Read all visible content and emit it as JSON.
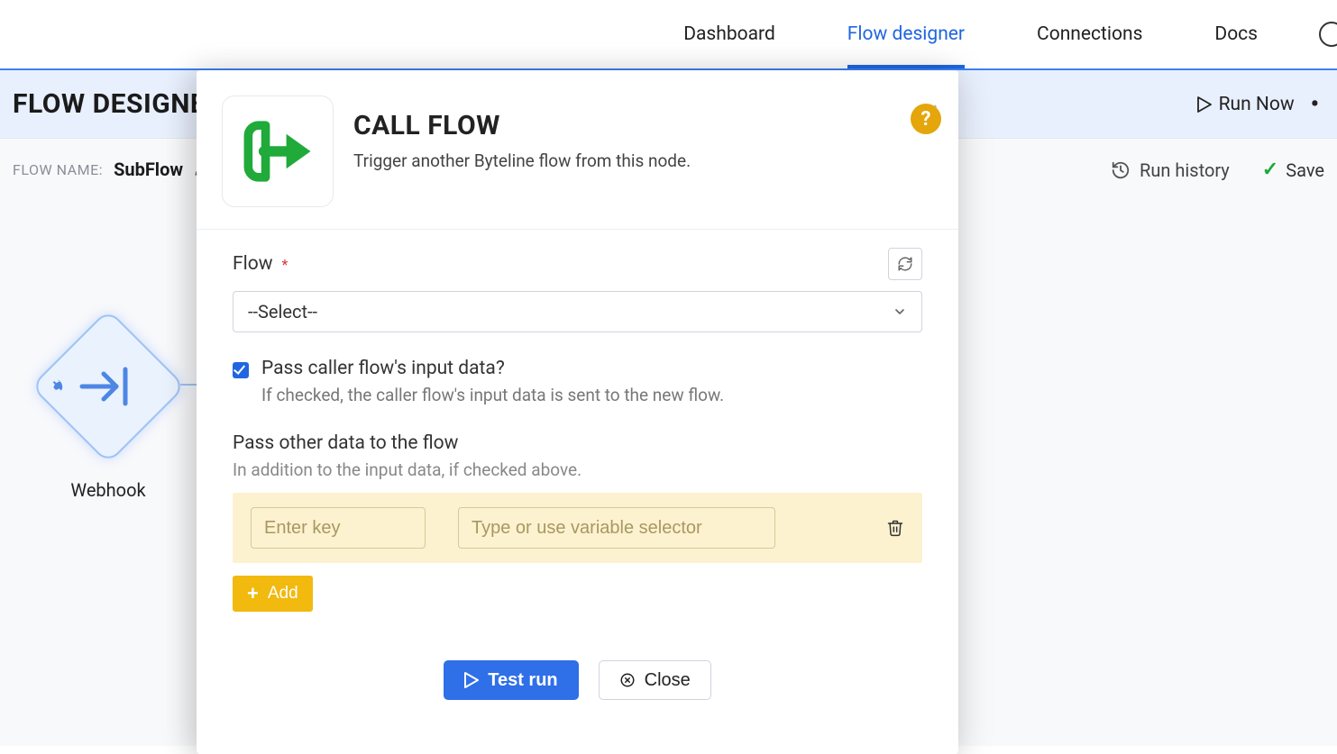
{
  "nav": {
    "tabs": {
      "dashboard": "Dashboard",
      "flowDesigner": "Flow designer",
      "connections": "Connections",
      "docs": "Docs"
    }
  },
  "header": {
    "title": "FLOW DESIGNER",
    "runNow": "Run Now",
    "dots": "•"
  },
  "canvas": {
    "flowNameLabel": "FLOW NAME:",
    "flowNameValue": "SubFlow",
    "runHistory": "Run history",
    "save": "Save",
    "node": {
      "label": "Webhook"
    }
  },
  "modal": {
    "title": "CALL FLOW",
    "subtitle": "Trigger another Byteline flow from this node.",
    "flowLabel": "Flow",
    "selectPlaceholder": "--Select--",
    "passCaller": {
      "label": "Pass caller flow's input data?",
      "help": "If checked, the caller flow's input data is sent to the new flow.",
      "checked": true
    },
    "passOther": {
      "heading": "Pass other data to the flow",
      "help": "In addition to the input data, if checked above.",
      "keyPlaceholder": "Enter key",
      "valPlaceholder": "Type or use variable selector"
    },
    "addLabel": "Add",
    "testRun": "Test run",
    "close": "Close",
    "helpBadge": "?"
  }
}
